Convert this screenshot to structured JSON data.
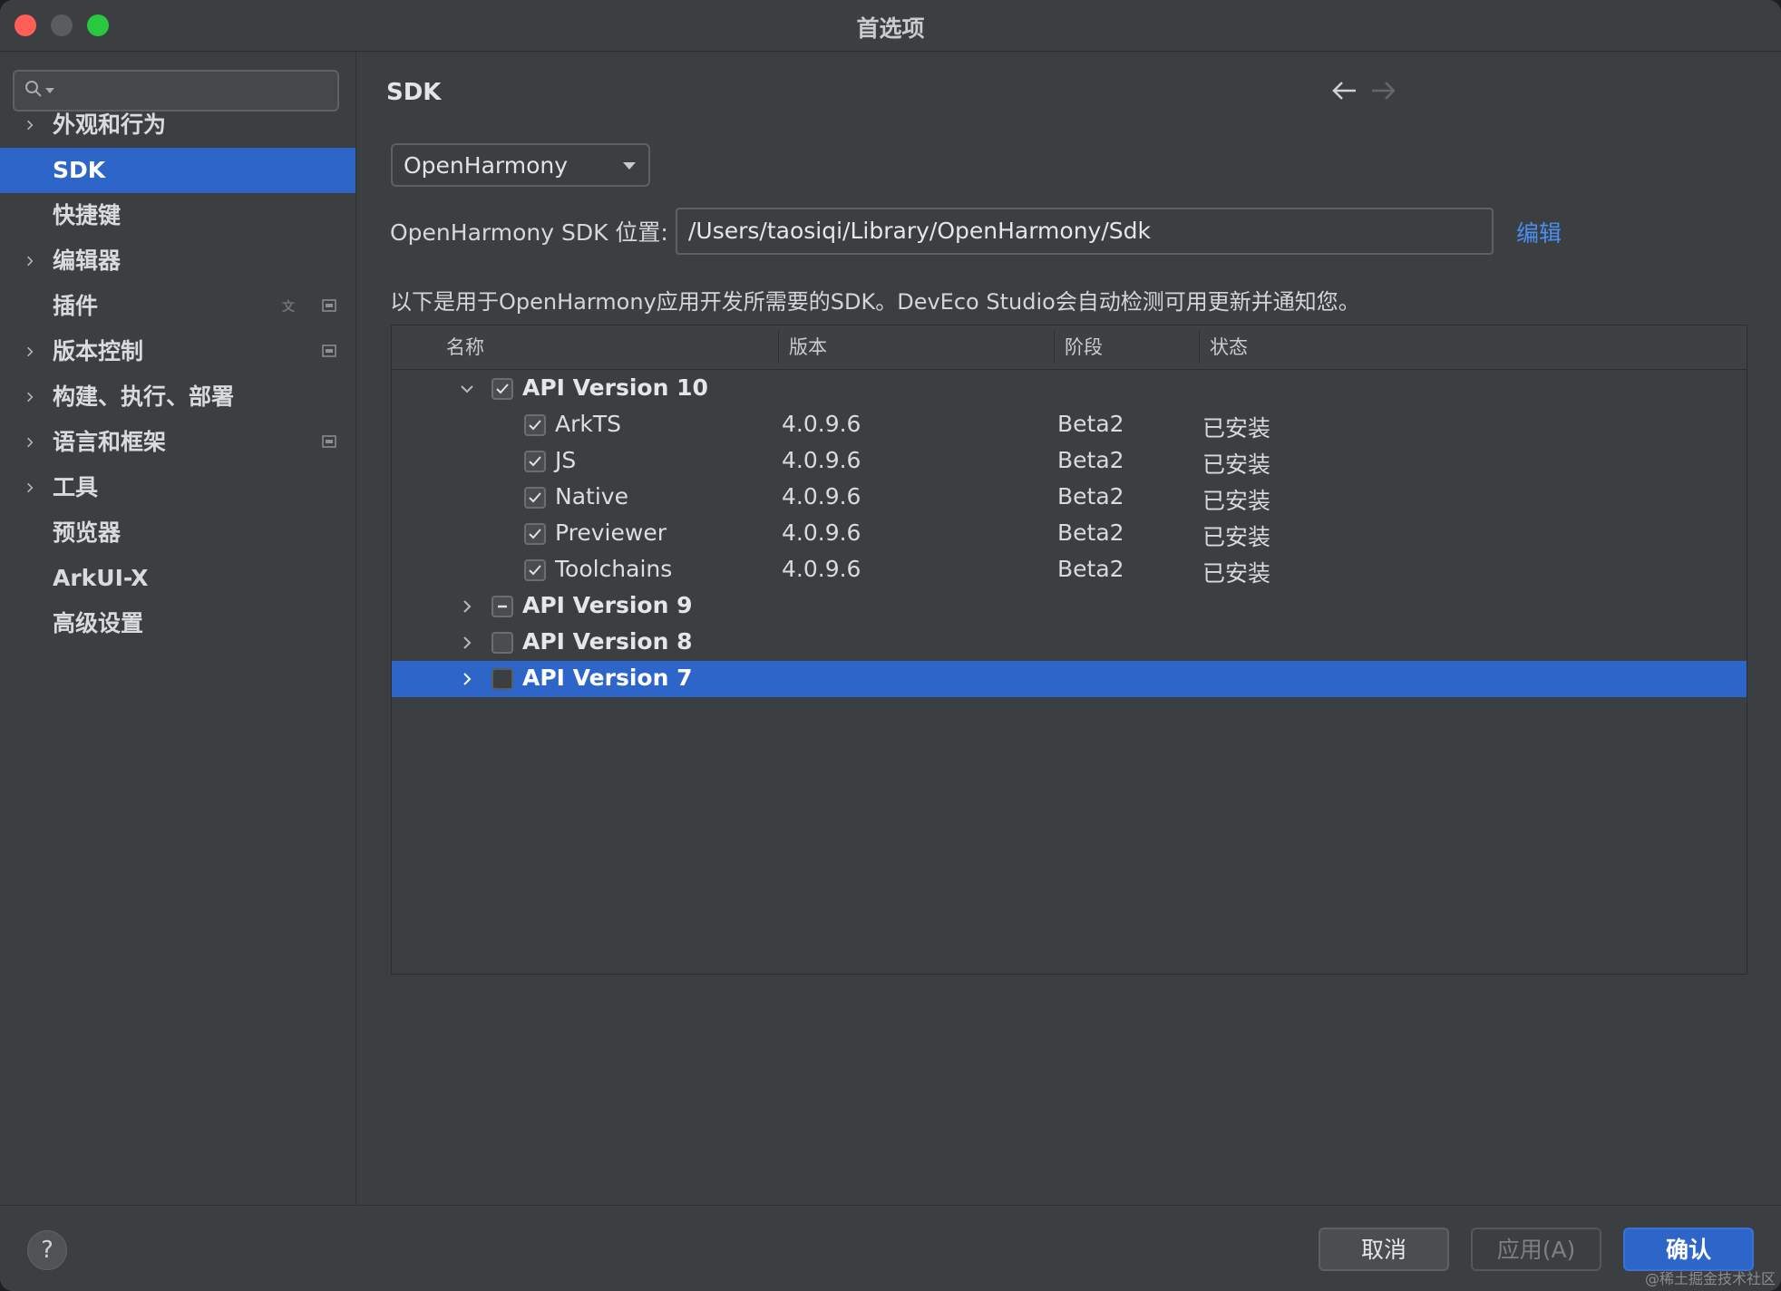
{
  "window": {
    "title": "首选项"
  },
  "sidebar": {
    "search": {
      "placeholder": "",
      "value": ""
    },
    "items": [
      {
        "label": "外观和行为",
        "expandable": true
      },
      {
        "label": "SDK",
        "expandable": false,
        "selected": true
      },
      {
        "label": "快捷键",
        "expandable": false
      },
      {
        "label": "编辑器",
        "expandable": true
      },
      {
        "label": "插件",
        "expandable": false,
        "trailing_icons": [
          "translate-icon",
          "panel-icon"
        ]
      },
      {
        "label": "版本控制",
        "expandable": true,
        "trailing_icons": [
          "panel-icon"
        ]
      },
      {
        "label": "构建、执行、部署",
        "expandable": true
      },
      {
        "label": "语言和框架",
        "expandable": true,
        "trailing_icons": [
          "panel-icon"
        ]
      },
      {
        "label": "工具",
        "expandable": true
      },
      {
        "label": "预览器",
        "expandable": false
      },
      {
        "label": "ArkUI-X",
        "expandable": false
      },
      {
        "label": "高级设置",
        "expandable": false
      }
    ]
  },
  "main": {
    "title": "SDK",
    "sdk_type": "OpenHarmony",
    "path_label": "OpenHarmony SDK 位置:",
    "path_value": "/Users/taosiqi/Library/OpenHarmony/Sdk",
    "edit_label": "编辑",
    "info": "以下是用于OpenHarmony应用开发所需要的SDK。DevEco Studio会自动检测可用更新并通知您。",
    "table": {
      "columns": [
        "名称",
        "版本",
        "阶段",
        "状态"
      ],
      "rows": [
        {
          "name": "API Version 10",
          "level": 0,
          "expanded": true,
          "check": "checked",
          "version": "",
          "stage": "",
          "status": ""
        },
        {
          "name": "ArkTS",
          "level": 1,
          "check": "checked",
          "version": "4.0.9.6",
          "stage": "Beta2",
          "status": "已安装"
        },
        {
          "name": "JS",
          "level": 1,
          "check": "checked",
          "version": "4.0.9.6",
          "stage": "Beta2",
          "status": "已安装"
        },
        {
          "name": "Native",
          "level": 1,
          "check": "checked",
          "version": "4.0.9.6",
          "stage": "Beta2",
          "status": "已安装"
        },
        {
          "name": "Previewer",
          "level": 1,
          "check": "checked",
          "version": "4.0.9.6",
          "stage": "Beta2",
          "status": "已安装"
        },
        {
          "name": "Toolchains",
          "level": 1,
          "check": "checked",
          "version": "4.0.9.6",
          "stage": "Beta2",
          "status": "已安装"
        },
        {
          "name": "API Version 9",
          "level": 0,
          "expanded": false,
          "check": "partial",
          "version": "",
          "stage": "",
          "status": ""
        },
        {
          "name": "API Version 8",
          "level": 0,
          "expanded": false,
          "check": "unchecked",
          "version": "",
          "stage": "",
          "status": ""
        },
        {
          "name": "API Version 7",
          "level": 0,
          "expanded": false,
          "check": "unchecked",
          "selected": true,
          "version": "",
          "stage": "",
          "status": ""
        }
      ]
    }
  },
  "footer": {
    "help": "?",
    "cancel": "取消",
    "apply": "应用(A)",
    "ok": "确认",
    "watermark": "@稀土掘金技术社区"
  },
  "colors": {
    "accent": "#2e65c9",
    "link": "#4a8ff0",
    "background": "#3c3f41"
  }
}
